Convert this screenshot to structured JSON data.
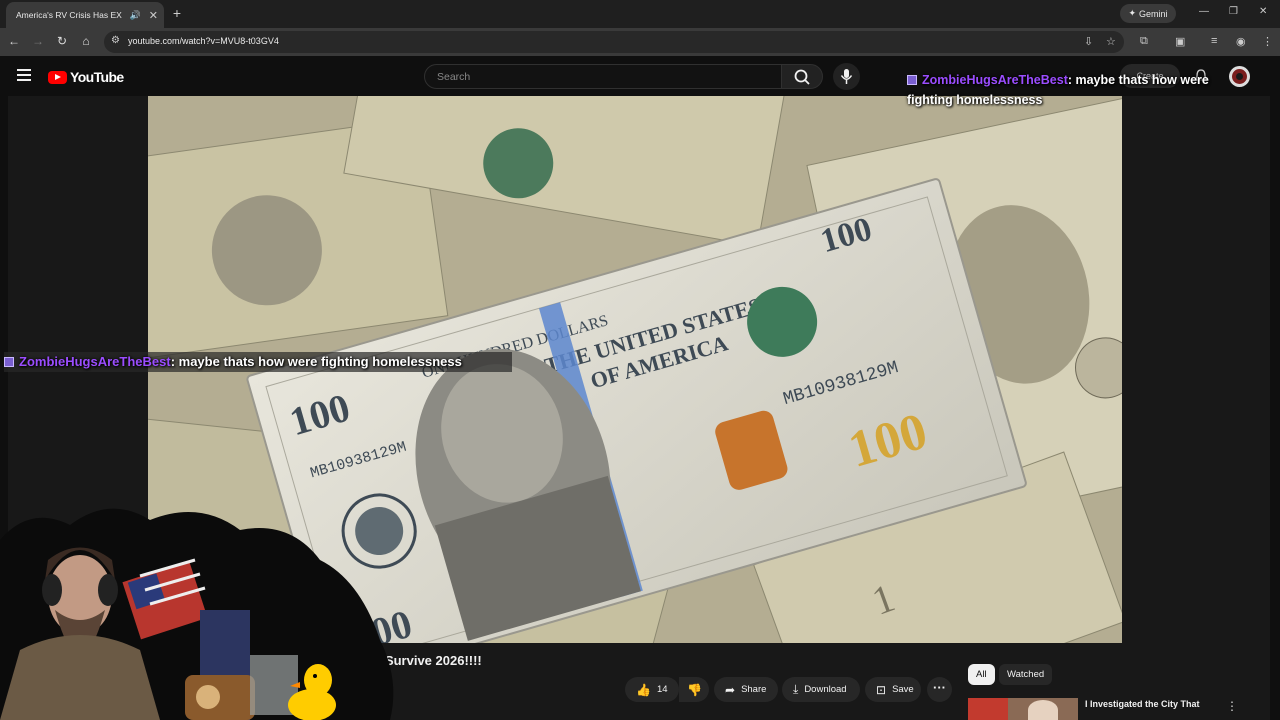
{
  "browser": {
    "tab_title": "America's RV Crisis Has EX",
    "tab_audio_icon": "speaker-icon",
    "new_tab": "+",
    "gemini_label": "Gemini",
    "url": "youtube.com/watch?v=MVU8-t03GV4"
  },
  "youtube": {
    "logo_text": "YouTube",
    "search_placeholder": "Search",
    "create_label": "Create"
  },
  "chat": {
    "mid": {
      "user": "ZombieHugsAreTheBest",
      "message": ": maybe thats how were fighting homelessness"
    },
    "top": {
      "user": "ZombieHugsAreTheBest",
      "message": ": maybe thats how were fighting homelessness"
    }
  },
  "video": {
    "title_visible": "t Survive 2026!!!!",
    "like_count": "14",
    "share_label": "Share",
    "download_label": "Download",
    "save_label": "Save"
  },
  "sidebar": {
    "chips": [
      "All",
      "Watched"
    ],
    "recommendation_title": "I Investigated the City That"
  },
  "colors": {
    "accent_red": "#ff0000",
    "chat_user": "#9b4dff",
    "chrome_bg": "#1f1f1f"
  }
}
